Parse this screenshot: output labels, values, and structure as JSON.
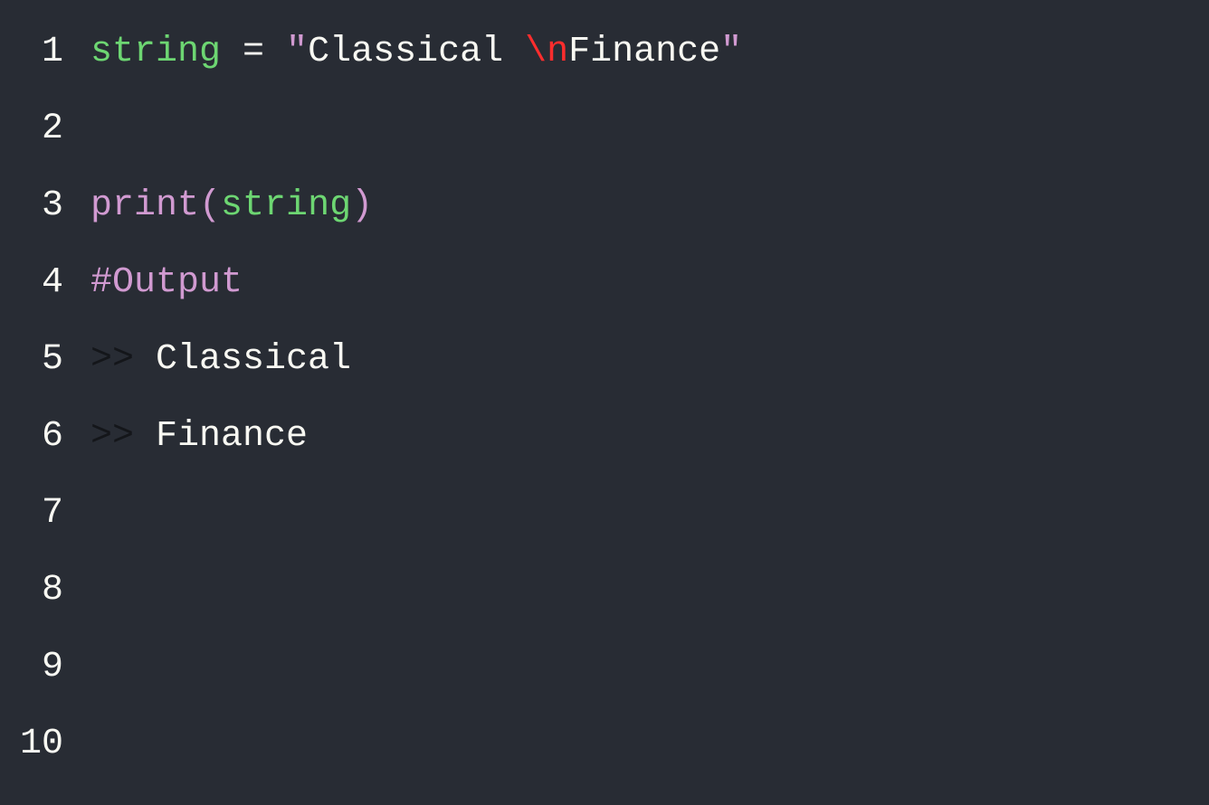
{
  "lineNumbers": [
    "1",
    "2",
    "3",
    "4",
    "5",
    "6",
    "7",
    "8",
    "9",
    "10"
  ],
  "code": {
    "l1": {
      "kw_string": "string",
      "sp_eq": " = ",
      "q1": "\"",
      "str_part1": "Classical ",
      "escape": "\\n",
      "str_part2": "Finance",
      "q2": "\""
    },
    "l2": "",
    "l3": {
      "fn_print": "print",
      "paren_open": "(",
      "arg": "string",
      "paren_close": ")"
    },
    "l4": {
      "comment": "#Output"
    },
    "l5": {
      "prompt": ">> ",
      "text": "Classical"
    },
    "l6": {
      "prompt": ">> ",
      "text": "Finance"
    }
  }
}
